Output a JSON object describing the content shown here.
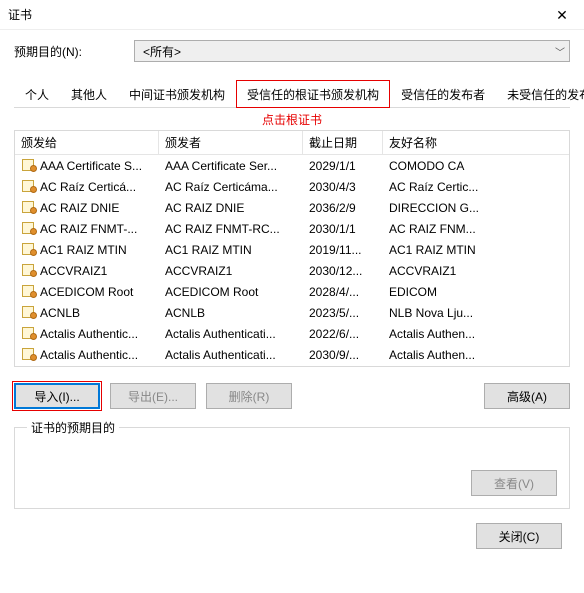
{
  "window": {
    "title": "证书",
    "close": "✕"
  },
  "purpose": {
    "label": "预期目的(N):",
    "selected": "<所有>"
  },
  "tabs": [
    {
      "label": "个人",
      "active": false
    },
    {
      "label": "其他人",
      "active": false
    },
    {
      "label": "中间证书颁发机构",
      "active": false
    },
    {
      "label": "受信任的根证书颁发机构",
      "active": true,
      "highlight": true
    },
    {
      "label": "受信任的发布者",
      "active": false
    },
    {
      "label": "未受信任的发布者",
      "active": false
    }
  ],
  "hint": "点击根证书",
  "columns": {
    "issued_to": "颁发给",
    "issued_by": "颁发者",
    "expires": "截止日期",
    "friendly": "友好名称"
  },
  "rows": [
    {
      "issued_to": "AAA Certificate S...",
      "issued_by": "AAA Certificate Ser...",
      "expires": "2029/1/1",
      "friendly": "COMODO CA"
    },
    {
      "issued_to": "AC Raíz Certicá...",
      "issued_by": "AC Raíz Certicáma...",
      "expires": "2030/4/3",
      "friendly": "AC Raíz Certic..."
    },
    {
      "issued_to": "AC RAIZ DNIE",
      "issued_by": "AC RAIZ DNIE",
      "expires": "2036/2/9",
      "friendly": "DIRECCION G..."
    },
    {
      "issued_to": "AC RAIZ FNMT-...",
      "issued_by": "AC RAIZ FNMT-RC...",
      "expires": "2030/1/1",
      "friendly": "AC RAIZ FNM..."
    },
    {
      "issued_to": "AC1 RAIZ MTIN",
      "issued_by": "AC1 RAIZ MTIN",
      "expires": "2019/11...",
      "friendly": "AC1 RAIZ MTIN"
    },
    {
      "issued_to": "ACCVRAIZ1",
      "issued_by": "ACCVRAIZ1",
      "expires": "2030/12...",
      "friendly": "ACCVRAIZ1"
    },
    {
      "issued_to": "ACEDICOM Root",
      "issued_by": "ACEDICOM Root",
      "expires": "2028/4/...",
      "friendly": "EDICOM"
    },
    {
      "issued_to": "ACNLB",
      "issued_by": "ACNLB",
      "expires": "2023/5/...",
      "friendly": "NLB Nova Lju..."
    },
    {
      "issued_to": "Actalis Authentic...",
      "issued_by": "Actalis Authenticati...",
      "expires": "2022/6/...",
      "friendly": "Actalis Authen..."
    },
    {
      "issued_to": "Actalis Authentic...",
      "issued_by": "Actalis Authenticati...",
      "expires": "2030/9/...",
      "friendly": "Actalis Authen..."
    }
  ],
  "buttons": {
    "import": "导入(I)...",
    "export": "导出(E)...",
    "remove": "删除(R)",
    "advanced": "高级(A)",
    "view": "查看(V)",
    "close": "关闭(C)"
  },
  "groupbox": {
    "legend": "证书的预期目的"
  }
}
